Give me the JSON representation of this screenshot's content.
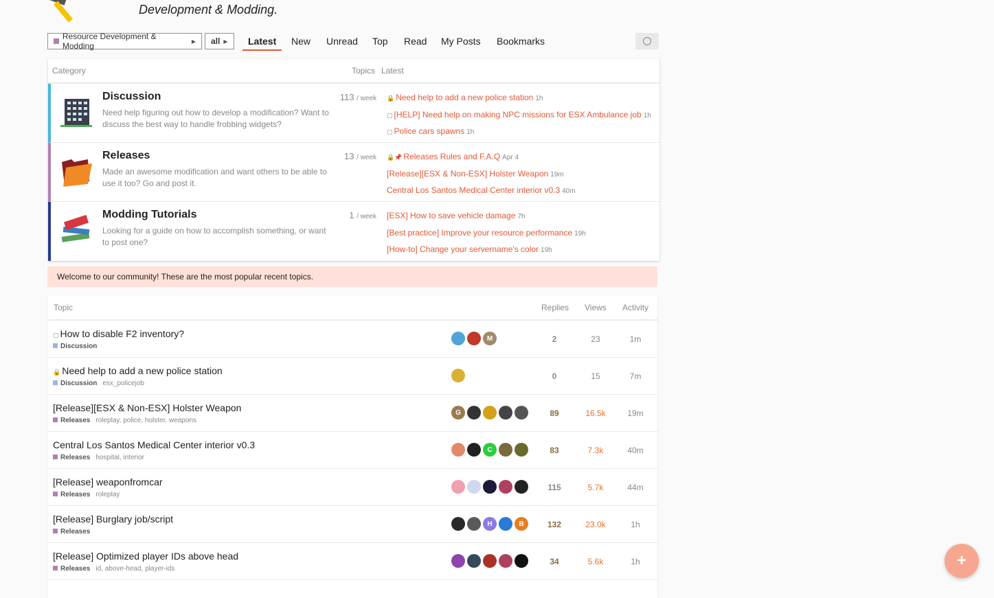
{
  "header": {
    "title": "Development & Modding."
  },
  "nav": {
    "category_filter": "Resource Development & Modding",
    "tag_filter": "all",
    "tabs": [
      "Latest",
      "New",
      "Unread",
      "Top",
      "Read",
      "My Posts",
      "Bookmarks"
    ]
  },
  "categories_table": {
    "headers": {
      "category": "Category",
      "topics": "Topics",
      "latest": "Latest"
    },
    "per": "/ week",
    "rows": [
      {
        "name": "Discussion",
        "description": "Need help figuring out how to develop a modification? Want to discuss the best way to handle frobbing widgets?",
        "count": "113",
        "latest": [
          {
            "icon": "lock",
            "title": "Need help to add a new police station",
            "age": "1h"
          },
          {
            "icon": "box",
            "title": "[HELP] Need help on making NPC missions for ESX Ambulance job",
            "age": "1h"
          },
          {
            "icon": "box",
            "title": "Police cars spawns",
            "age": "1h"
          }
        ]
      },
      {
        "name": "Releases",
        "description": "Made an awesome modification and want others to be able to use it too? Go and post it.",
        "count": "13",
        "latest": [
          {
            "icon": "lock-pin",
            "title": "Releases Rules and F.A.Q",
            "age": "Apr 4"
          },
          {
            "icon": "",
            "title": "[Release][ESX & Non-ESX] Holster Weapon",
            "age": "19m"
          },
          {
            "icon": "",
            "title": "Central Los Santos Medical Center interior v0.3",
            "age": "40m"
          }
        ]
      },
      {
        "name": "Modding Tutorials",
        "description": "Looking for a guide on how to accomplish something, or want to post one?",
        "count": "1",
        "latest": [
          {
            "icon": "",
            "title": "[ESX] How to save vehicle damage",
            "age": "7h"
          },
          {
            "icon": "",
            "title": "[Best practice] Improve your resource performance",
            "age": "19h"
          },
          {
            "icon": "",
            "title": "[How-to] Change your servername's color",
            "age": "19h"
          }
        ]
      }
    ]
  },
  "welcome": "Welcome to our community! These are the most popular recent topics.",
  "topics_table": {
    "headers": {
      "topic": "Topic",
      "replies": "Replies",
      "views": "Views",
      "activity": "Activity"
    },
    "rows": [
      {
        "icon": "box",
        "title": "How to disable F2 inventory?",
        "category": "Discussion",
        "tags": "",
        "replies": "2",
        "views": "23",
        "activity": "1m",
        "avatars": [
          "",
          "",
          "M"
        ]
      },
      {
        "icon": "lock",
        "title": "Need help to add a new police station",
        "category": "Discussion",
        "tags": "esx_policejob",
        "replies": "0",
        "views": "15",
        "activity": "7m",
        "avatars": [
          ""
        ]
      },
      {
        "icon": "",
        "title": "[Release][ESX & Non-ESX] Holster Weapon",
        "category": "Releases",
        "tags": "roleplay, police, holster, weapons",
        "replies": "89",
        "views": "16.5k",
        "activity": "19m",
        "avatars": [
          "G",
          "",
          "",
          "",
          ""
        ]
      },
      {
        "icon": "",
        "title": "Central Los Santos Medical Center interior v0.3",
        "category": "Releases",
        "tags": "hospital, interior",
        "replies": "83",
        "views": "7.3k",
        "activity": "40m",
        "avatars": [
          "",
          "",
          "C",
          "",
          ""
        ]
      },
      {
        "icon": "",
        "title": "[Release] weaponfromcar",
        "category": "Releases",
        "tags": "roleplay",
        "replies": "115",
        "views": "5.7k",
        "activity": "44m",
        "avatars": [
          "",
          "",
          "",
          "",
          ""
        ]
      },
      {
        "icon": "",
        "title": "[Release] Burglary job/script",
        "category": "Releases",
        "tags": "",
        "replies": "132",
        "views": "23.0k",
        "activity": "1h",
        "avatars": [
          "",
          "",
          "H",
          "",
          "B"
        ]
      },
      {
        "icon": "",
        "title": "[Release] Optimized player IDs above head",
        "category": "Releases",
        "tags": "id, above-head, player-ids",
        "replies": "34",
        "views": "5.6k",
        "activity": "1h",
        "avatars": [
          "",
          "",
          "",
          "",
          ""
        ]
      }
    ]
  },
  "fab_label": "+"
}
